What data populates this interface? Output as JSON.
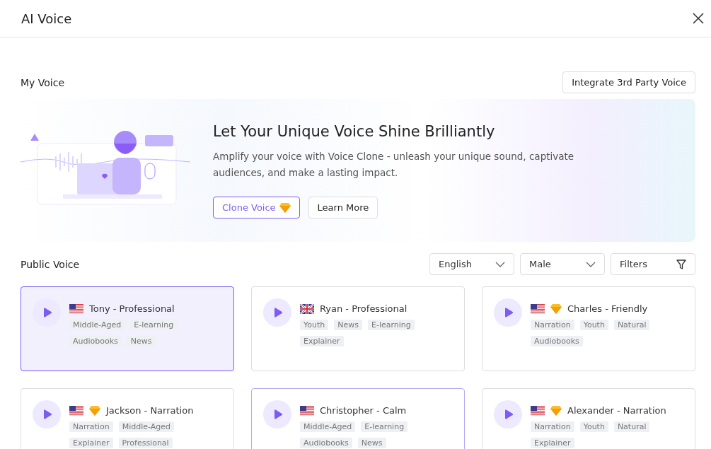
{
  "window": {
    "title": "AI Voice"
  },
  "my_voice": {
    "title": "My Voice",
    "integrate_button": "Integrate 3rd Party Voice"
  },
  "banner": {
    "heading": "Let Your Unique Voice Shine Brilliantly",
    "description": "Amplify your voice with Voice Clone - unleash your unique sound, captivate audiences, and make a lasting impact.",
    "buttons": [
      {
        "label": "Clone Voice",
        "kind": "primary",
        "premium": true
      },
      {
        "label": "Learn More",
        "kind": "secondary",
        "premium": false
      }
    ]
  },
  "public_voice": {
    "title": "Public Voice",
    "filters": [
      {
        "kind": "dropdown",
        "value": "English"
      },
      {
        "kind": "dropdown",
        "value": "Male"
      },
      {
        "kind": "filter",
        "value": "Filters"
      }
    ],
    "voices": [
      {
        "name": "Tony - Professional",
        "flag": {
          "kind": "us"
        },
        "premium": false,
        "selected": true,
        "hovered": false,
        "tags": [
          "Middle-Aged",
          "E-learning",
          "Audiobooks",
          "News"
        ]
      },
      {
        "name": "Ryan - Professional",
        "flag": {
          "kind": "uk"
        },
        "premium": false,
        "selected": false,
        "hovered": false,
        "tags": [
          "Youth",
          "News",
          "E-learning",
          "Explainer"
        ]
      },
      {
        "name": "Charles - Friendly",
        "flag": {
          "kind": "us"
        },
        "premium": true,
        "selected": false,
        "hovered": false,
        "tags": [
          "Narration",
          "Youth",
          "Natural",
          "Audiobooks"
        ]
      },
      {
        "name": "Jackson - Narration",
        "flag": {
          "kind": "us"
        },
        "premium": true,
        "selected": false,
        "hovered": false,
        "tags": [
          "Narration",
          "Middle-Aged",
          "Explainer",
          "Professional"
        ]
      },
      {
        "name": "Christopher - Calm",
        "flag": {
          "kind": "us"
        },
        "premium": false,
        "selected": false,
        "hovered": true,
        "tags": [
          "Middle-Aged",
          "E-learning",
          "Audiobooks",
          "News"
        ]
      },
      {
        "name": "Alexander - Narration",
        "flag": {
          "kind": "us"
        },
        "premium": true,
        "selected": false,
        "hovered": false,
        "tags": [
          "Narration",
          "Youth",
          "Natural",
          "Explainer"
        ]
      }
    ]
  }
}
